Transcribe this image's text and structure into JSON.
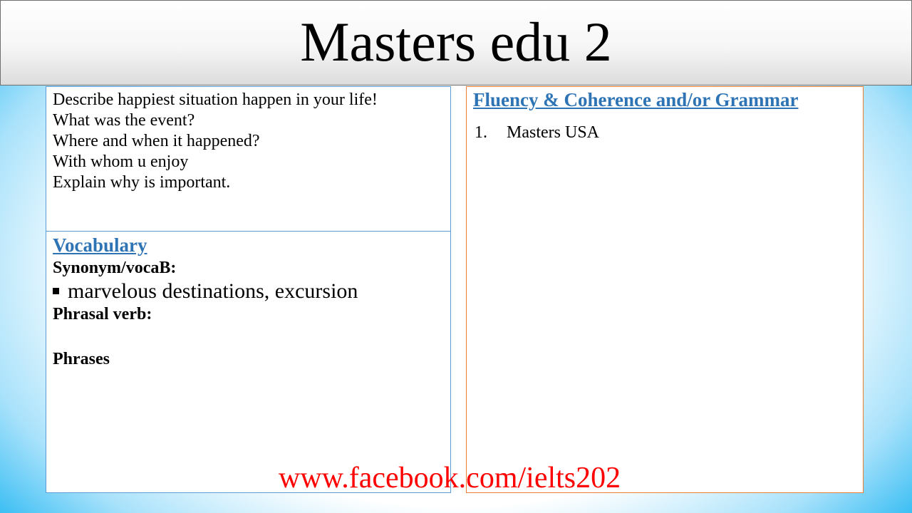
{
  "header": {
    "title": "Masters edu 2"
  },
  "prompt": {
    "lines": [
      "Describe happiest situation happen in your life!",
      "What was the event?",
      "Where and when it happened?",
      "With whom u enjoy",
      "Explain why is important."
    ]
  },
  "vocabulary": {
    "heading": "Vocabulary",
    "synonym_label": "Synonym/vocaB:",
    "bullet_text": "marvelous destinations, excursion",
    "phrasal_label": "Phrasal verb:",
    "phrases_label": "Phrases"
  },
  "fluency": {
    "heading": "Fluency & Coherence and/or Grammar",
    "items": [
      {
        "number": "1.",
        "text": "Masters USA"
      }
    ]
  },
  "footer": {
    "link_text": "www.facebook.com/ielts202"
  },
  "colors": {
    "heading_blue": "#2e74b5",
    "link_red": "#ff0000",
    "left_border": "#5b9bd5",
    "right_border": "#ed7d31",
    "background_edge": "#1aaeee"
  }
}
